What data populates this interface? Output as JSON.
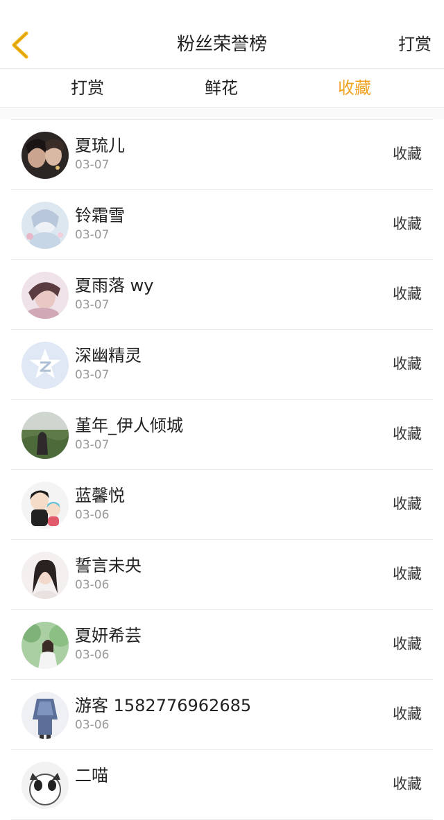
{
  "header": {
    "title": "粉丝荣誉榜",
    "right_action": "打赏"
  },
  "tabs": [
    {
      "label": "打赏",
      "active": false
    },
    {
      "label": "鲜花",
      "active": false
    },
    {
      "label": "收藏",
      "active": true
    }
  ],
  "colors": {
    "accent": "#f0a320",
    "back_icon": "#f2b515"
  },
  "fans": [
    {
      "name": "夏琉儿",
      "date": "03-07",
      "action": "收藏"
    },
    {
      "name": "铃霜雪",
      "date": "03-07",
      "action": "收藏"
    },
    {
      "name": "夏雨落 wy",
      "date": "03-07",
      "action": "收藏"
    },
    {
      "name": "深幽精灵",
      "date": "03-07",
      "action": "收藏"
    },
    {
      "name": "堇年_伊人倾城",
      "date": "03-07",
      "action": "收藏"
    },
    {
      "name": "蓝馨悦",
      "date": "03-06",
      "action": "收藏"
    },
    {
      "name": "誓言未央",
      "date": "03-06",
      "action": "收藏"
    },
    {
      "name": "夏妍希芸",
      "date": "03-06",
      "action": "收藏"
    },
    {
      "name": "游客 1582776962685",
      "date": "03-06",
      "action": "收藏"
    },
    {
      "name": "二喵",
      "date": "",
      "action": "收藏"
    }
  ]
}
